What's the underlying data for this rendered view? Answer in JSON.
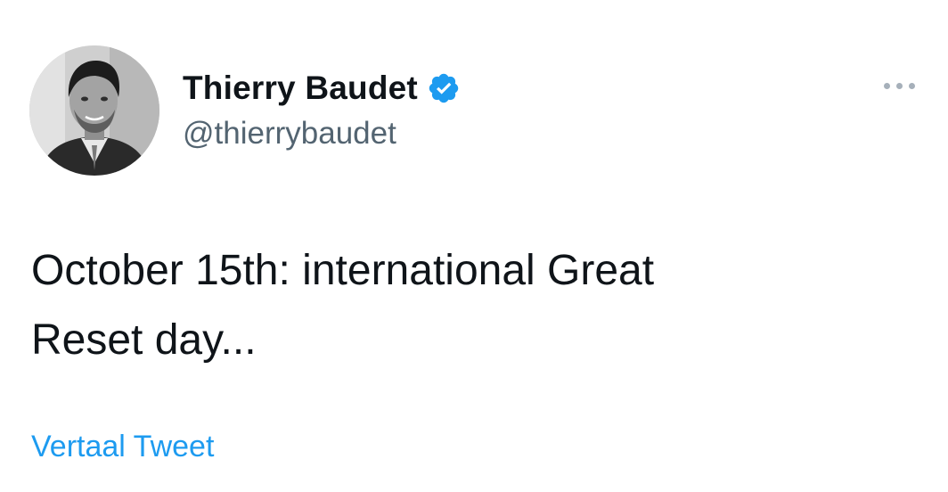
{
  "tweet": {
    "author": {
      "display_name": "Thierry Baudet",
      "handle": "@thierrybaudet",
      "verified": true,
      "avatar_icon": "profile-photo",
      "verified_icon": "verified-badge-icon"
    },
    "text": "October 15th: international Great\nReset day...",
    "translate_label": "Vertaal Tweet",
    "more_icon": "more-options-icon"
  },
  "colors": {
    "name": "#0f1419",
    "handle": "#536471",
    "link": "#1d9bf0",
    "verified": "#1d9bf0",
    "more_dots": "#a6b0ba"
  }
}
